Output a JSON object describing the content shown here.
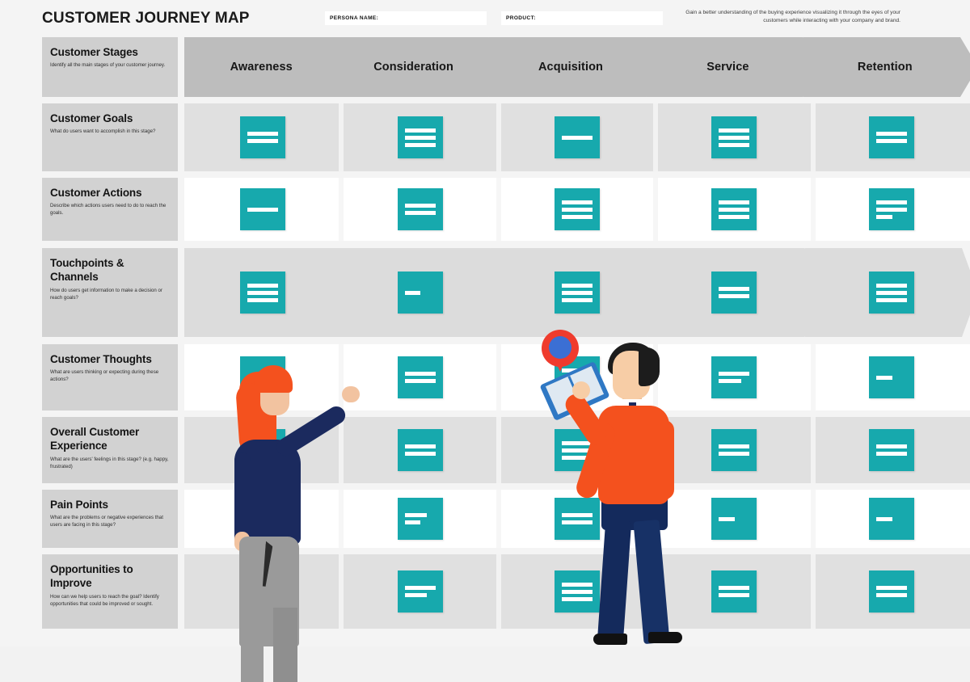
{
  "header": {
    "title": "CUSTOMER JOURNEY MAP",
    "persona_label": "PERSONA NAME:",
    "persona_value": "",
    "product_label": "PRODUCT:",
    "product_value": "",
    "blurb": "Gain a better understanding of the buying experience visualizing it through the eyes of your customers while interacting with your company and brand."
  },
  "stages": [
    {
      "label": "Awareness"
    },
    {
      "label": "Consideration"
    },
    {
      "label": "Acquisition"
    },
    {
      "label": "Service"
    },
    {
      "label": "Retention"
    }
  ],
  "rows": [
    {
      "title": "Customer Stages",
      "desc": "Identify all the main stages of your customer journey.",
      "cards": []
    },
    {
      "title": "Customer Goals",
      "desc": "What do users want to accomplish in this stage?",
      "cards": [
        {
          "lines": [
            "full",
            "full"
          ]
        },
        {
          "lines": [
            "full",
            "full",
            "full"
          ]
        },
        {
          "lines": [
            "full"
          ]
        },
        {
          "lines": [
            "full",
            "full",
            "full"
          ]
        },
        {
          "lines": [
            "full",
            "full"
          ]
        }
      ]
    },
    {
      "title": "Customer Actions",
      "desc": "Describe which actions users need to do to reach the goals.",
      "cards": [
        {
          "lines": [
            "full"
          ]
        },
        {
          "lines": [
            "full",
            "full"
          ]
        },
        {
          "lines": [
            "full",
            "full",
            "full"
          ]
        },
        {
          "lines": [
            "full",
            "full",
            "full"
          ]
        },
        {
          "lines": [
            "full",
            "full",
            "short"
          ]
        }
      ]
    },
    {
      "title": "Touchpoints & Channels",
      "desc": "How do users get information to make a decision or reach goals?",
      "cards": [
        {
          "lines": [
            "full",
            "full",
            "full"
          ]
        },
        {
          "lines": [
            "short"
          ]
        },
        {
          "lines": [
            "full",
            "full",
            "full"
          ]
        },
        {
          "lines": [
            "full",
            "full"
          ]
        },
        {
          "lines": [
            "full",
            "full",
            "full"
          ]
        }
      ]
    },
    {
      "title": "Customer Thoughts",
      "desc": "What are users thinking or expecting during these actions?",
      "cards": [
        {
          "lines": [
            "full"
          ]
        },
        {
          "lines": [
            "full",
            "full"
          ]
        },
        {
          "lines": [
            "full",
            "full",
            "full"
          ]
        },
        {
          "lines": [
            "full",
            "medium"
          ]
        },
        {
          "lines": [
            "short"
          ]
        }
      ]
    },
    {
      "title": "Overall Customer Experience",
      "desc": "What are the users' feelings in this stage? (e.g. happy, frustrated)",
      "cards": [
        {
          "lines": [
            "full",
            "short"
          ]
        },
        {
          "lines": [
            "full",
            "full"
          ]
        },
        {
          "lines": [
            "full",
            "full",
            "full"
          ]
        },
        {
          "lines": [
            "full",
            "full"
          ]
        },
        {
          "lines": [
            "full",
            "full"
          ]
        }
      ]
    },
    {
      "title": "Pain Points",
      "desc": "What are the problems or negative experiences that users are facing in this stage?",
      "cards": [
        {
          "lines": [
            "full",
            "full"
          ]
        },
        {
          "lines": [
            "medium",
            "short"
          ]
        },
        {
          "lines": [
            "full",
            "full"
          ]
        },
        {
          "lines": [
            "short"
          ]
        },
        {
          "lines": [
            "short"
          ]
        }
      ]
    },
    {
      "title": "Opportunities to Improve",
      "desc": "How can we help users to reach the goal? Identify opportunities that could be improved or sought.",
      "cards": [
        {
          "lines": [
            "full",
            "full",
            "full"
          ]
        },
        {
          "lines": [
            "full",
            "medium"
          ]
        },
        {
          "lines": [
            "full",
            "full",
            "full"
          ]
        },
        {
          "lines": [
            "full",
            "full"
          ]
        },
        {
          "lines": [
            "full",
            "full"
          ]
        }
      ]
    }
  ],
  "colors": {
    "card": "#17a9ad",
    "stage_header": "#bdbdbd",
    "row_label": "#d2d2d2",
    "row_alt": "#e0e0e0",
    "accent_orange": "#f4511e",
    "accent_navy": "#1b2a5e"
  }
}
